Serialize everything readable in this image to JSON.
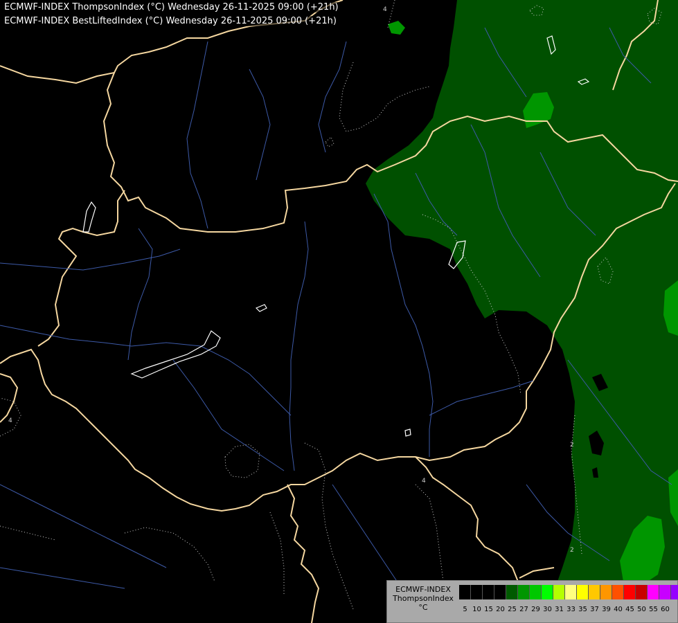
{
  "titles": {
    "line1": "ECMWF-INDEX ThompsonIndex (°C) Wednesday 26-11-2025 09:00 (+21h)",
    "line2": "ECMWF-INDEX BestLiftedIndex (°C) Wednesday 26-11-2025 09:00 (+21h)"
  },
  "legend": {
    "model": "ECMWF-INDEX",
    "parameter": "ThompsonIndex",
    "unit": "°C",
    "ticks": [
      "5",
      "10",
      "15",
      "20",
      "25",
      "27",
      "29",
      "30",
      "31",
      "33",
      "35",
      "37",
      "39",
      "40",
      "45",
      "50",
      "55",
      "60"
    ],
    "colors": [
      "#000000",
      "#000000",
      "#000000",
      "#000000",
      "#005a00",
      "#009600",
      "#00c800",
      "#00ff00",
      "#b4ff00",
      "#ffff80",
      "#ffff00",
      "#ffc800",
      "#ff9600",
      "#ff5000",
      "#ff0000",
      "#c80000",
      "#ff00ff",
      "#c800ff",
      "#9600ff",
      "#6400ff",
      "#0000ff"
    ]
  },
  "contour_labels": [
    "4",
    "4",
    "2",
    "2",
    "4"
  ],
  "colors": {
    "background": "#000000",
    "thompson_25": "#005000",
    "thompson_27": "#009600",
    "borders": "#f5d7a0",
    "rivers": "#3d5aa8",
    "lakes": "#ffffff",
    "contours": "#cccccc"
  }
}
